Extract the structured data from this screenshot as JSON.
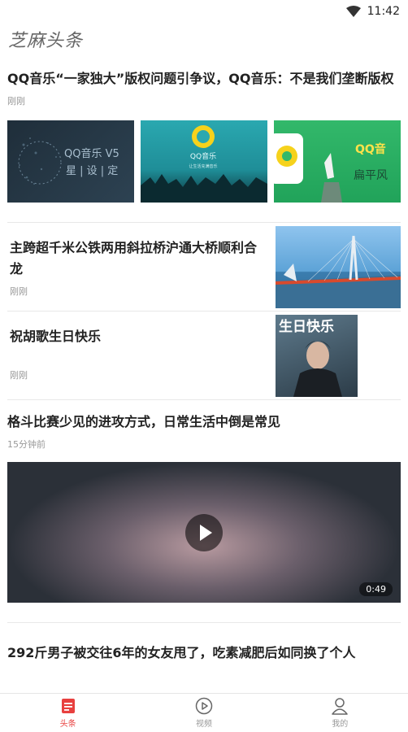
{
  "status_bar": {
    "time": "11:42"
  },
  "app": {
    "title": "芝麻头条"
  },
  "articles": [
    {
      "title": "QQ音乐“一家独大”版权问题引争议，QQ音乐：不是我们垄断版权",
      "time": "刚刚",
      "thumbs": [
        {
          "text_1": "QQ音乐 V5",
          "text_2": "星 | 设 | 定"
        },
        {
          "text_1": "QQ音乐",
          "text_2": "让生活充满音乐"
        },
        {
          "text_1": "QQ音",
          "text_2": "扁平风"
        }
      ]
    },
    {
      "title": "主跨超千米公铁两用斜拉桥沪通大桥顺利合龙",
      "time": "刚刚"
    },
    {
      "title": "祝胡歌生日快乐",
      "time": "刚刚",
      "thumb_text": "生日快乐"
    },
    {
      "title": "格斗比赛少见的进攻方式，日常生活中倒是常见",
      "time": "15分钟前",
      "duration": "0:49"
    },
    {
      "title": "292斤男子被交往6年的女友甩了，吃素减肥后如同换了个人"
    }
  ],
  "tabs": [
    {
      "label": "头条",
      "icon": "news-icon",
      "active": true
    },
    {
      "label": "视频",
      "icon": "play-circle-icon",
      "active": false
    },
    {
      "label": "我的",
      "icon": "person-icon",
      "active": false
    }
  ],
  "colors": {
    "accent": "#e8403f",
    "muted": "#999999",
    "title": "#222222"
  }
}
